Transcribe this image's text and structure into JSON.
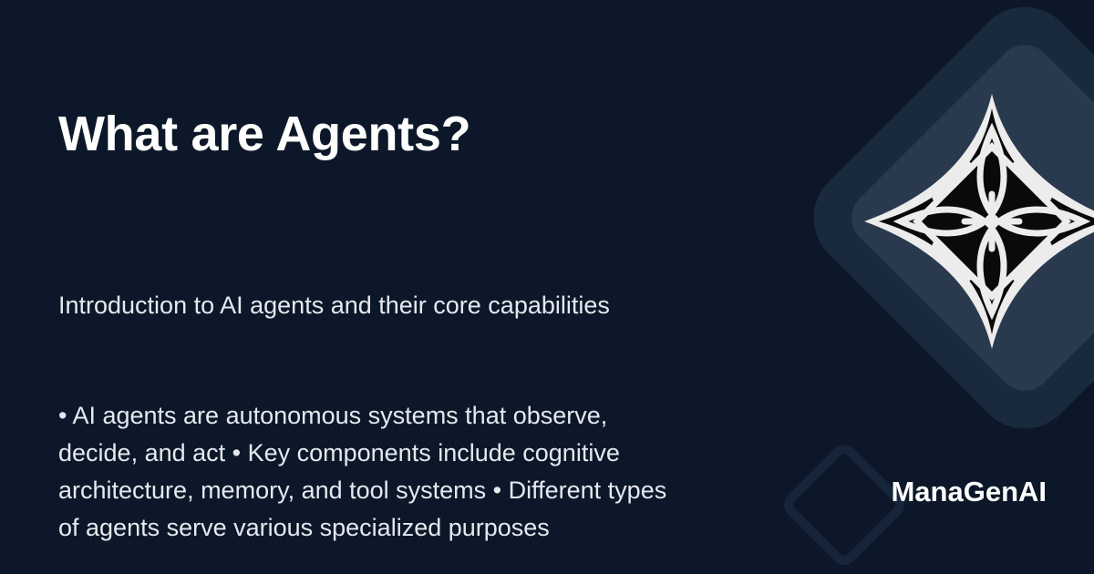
{
  "card": {
    "title": "What are Agents?",
    "subtitle": "Introduction to AI agents and their core capabilities",
    "description": "• AI agents are autonomous systems that observe, decide, and act • Key components include cognitive architecture, memory, and tool systems • Different types of agents serve various specialized purposes",
    "brand": "ManaGenAI"
  },
  "colors": {
    "background": "#0c1829",
    "decoration_dark": "#1a2a3d",
    "decoration_light": "#2a3a4e",
    "text": "#ffffff"
  },
  "icons": {
    "logo": "ornamental-diamond-icon",
    "decoration": "rounded-diamond-shape"
  }
}
